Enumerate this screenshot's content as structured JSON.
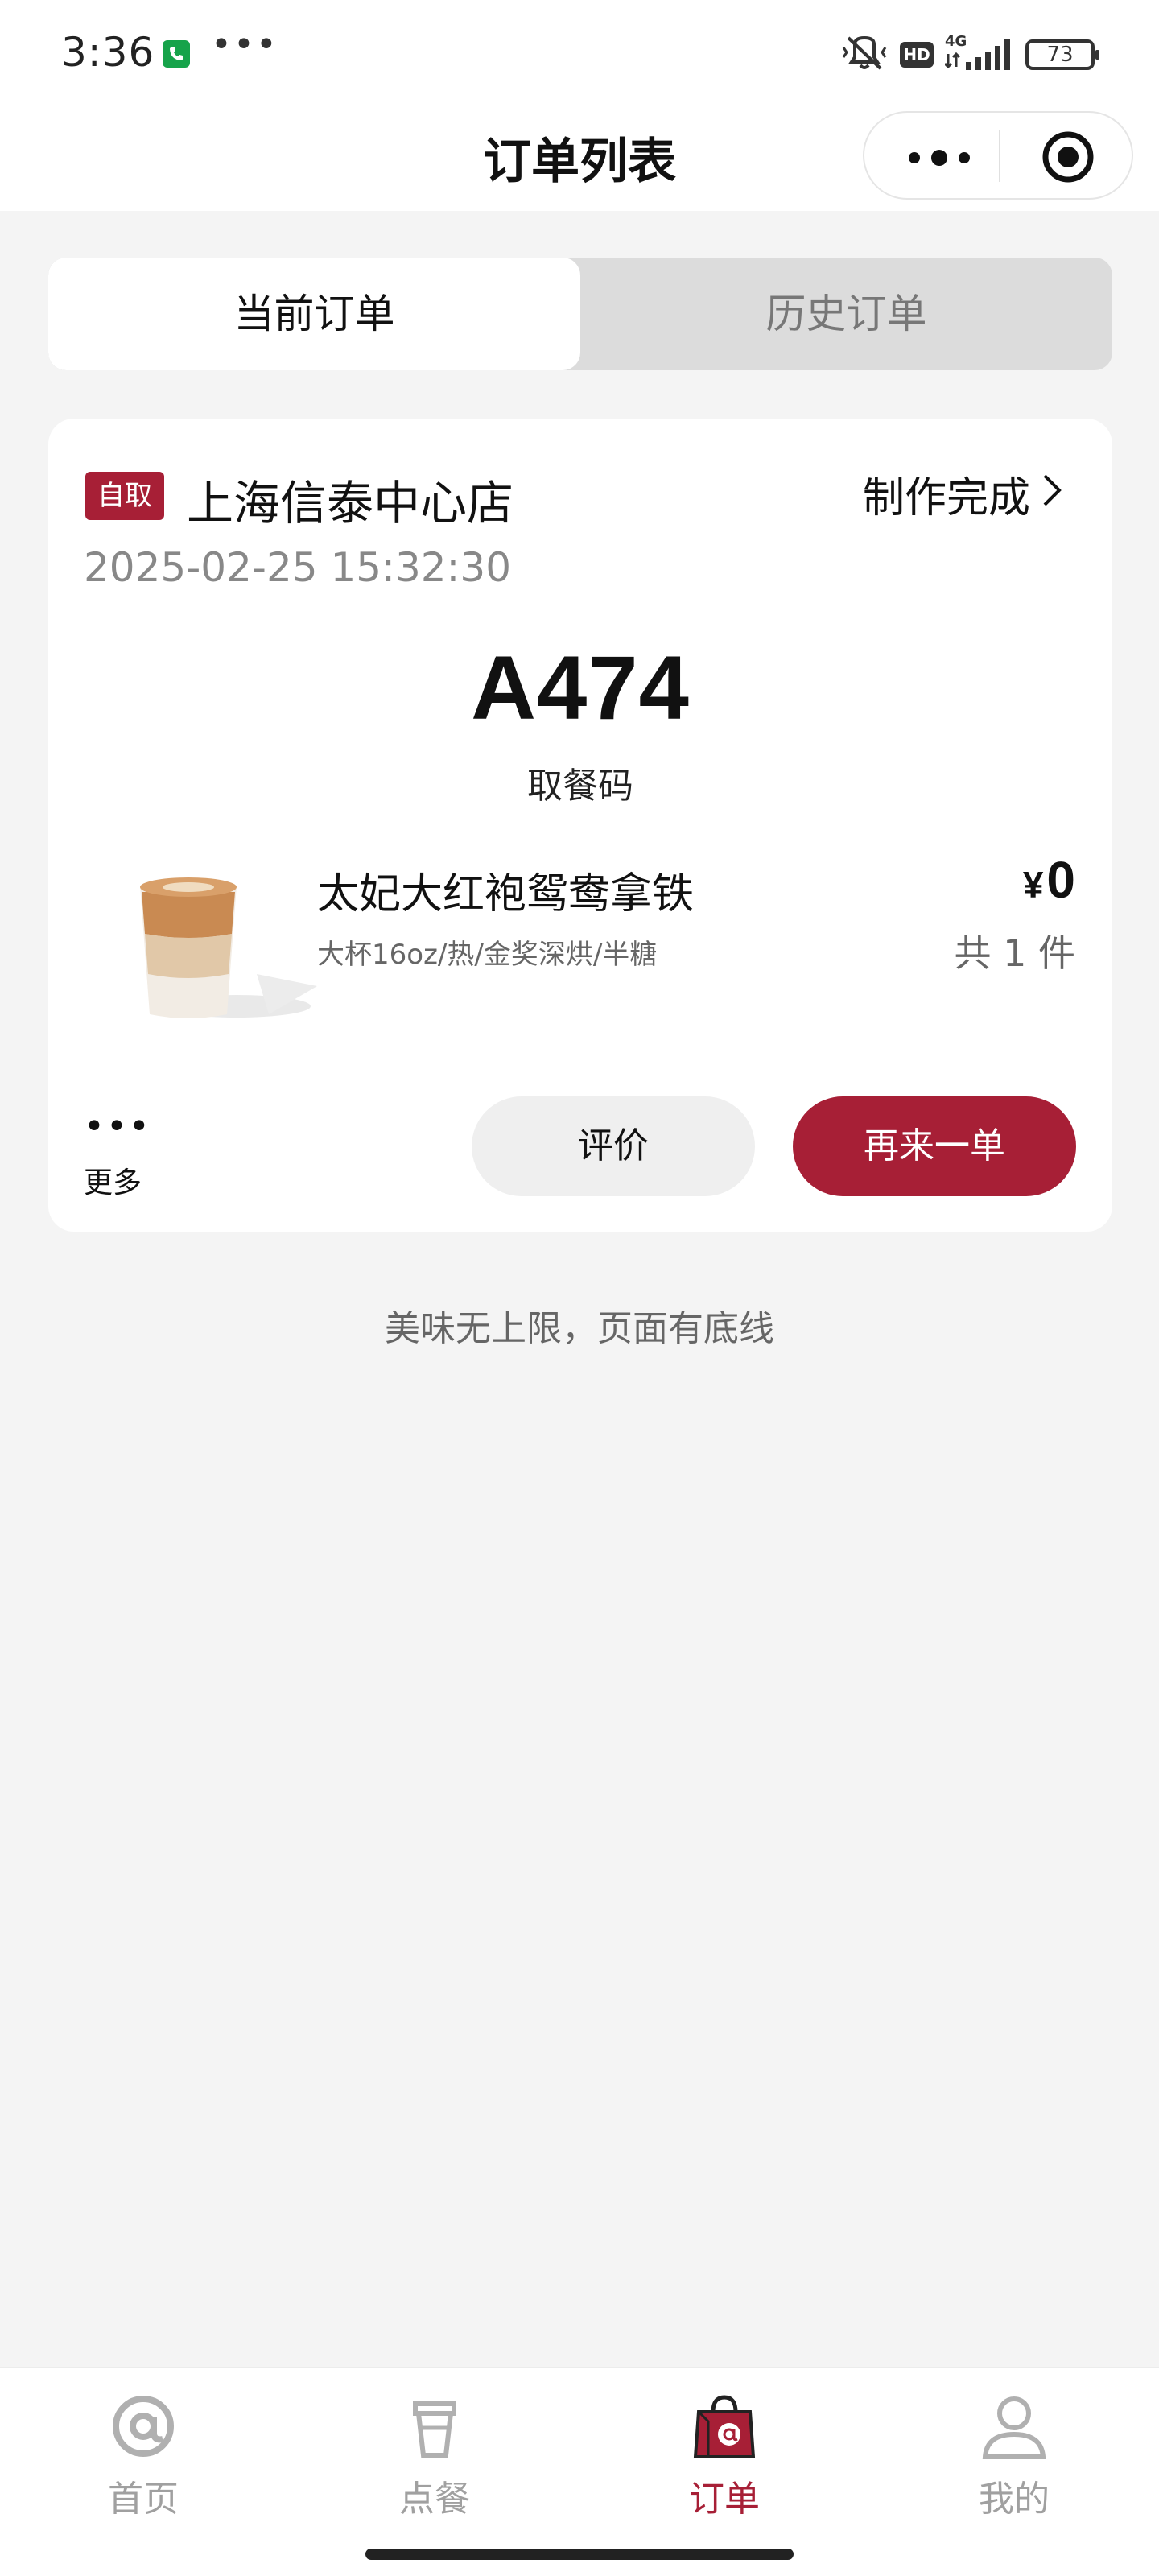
{
  "status_bar": {
    "time": "3:36",
    "dots": "•••",
    "battery": "73",
    "icons": [
      "call-icon",
      "vibrate-off-icon",
      "hd-icon",
      "4g-signal-icon",
      "battery-icon"
    ],
    "hd": "HD"
  },
  "header": {
    "title": "订单列表",
    "capsule_icons": [
      "more-icon",
      "close-target-icon"
    ]
  },
  "tabs": [
    {
      "label": "当前订单",
      "active": true
    },
    {
      "label": "历史订单",
      "active": false
    }
  ],
  "order": {
    "pickup_badge": "自取",
    "store_name": "上海信泰中心店",
    "status": "制作完成",
    "time": "2025-02-25 15:32:30",
    "pickup_code": "A474",
    "pickup_code_label": "取餐码",
    "product": {
      "name": "太妃大红袍鸳鸯拿铁",
      "spec": "大杯16oz/热/金奖深烘/半糖",
      "currency": "¥",
      "price": "0",
      "qty": "共 1 件"
    },
    "more_dots": "•••",
    "more_label": "更多",
    "review_label": "评价",
    "reorder_label": "再来一单"
  },
  "footer_note": "美味无上限，页面有底线",
  "bottom_nav": [
    {
      "label": "首页",
      "icon": "home-at-icon",
      "active": false
    },
    {
      "label": "点餐",
      "icon": "cup-icon",
      "active": false
    },
    {
      "label": "订单",
      "icon": "shopping-bag-icon",
      "active": true
    },
    {
      "label": "我的",
      "icon": "user-icon",
      "active": false
    }
  ],
  "colors": {
    "brand": "#a71f36",
    "background": "#f4f4f4",
    "inactive_nav": "#a0a0a0"
  }
}
